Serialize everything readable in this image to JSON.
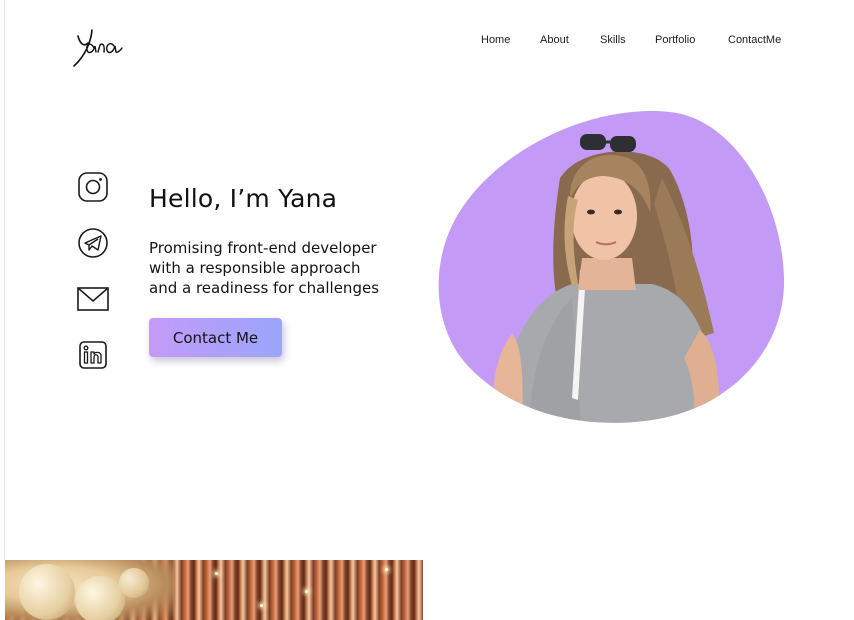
{
  "brand": {
    "logo_text": "Yana"
  },
  "nav": {
    "items": [
      "Home",
      "About",
      "Skills",
      "Portfolio",
      "ContactMe"
    ]
  },
  "social": {
    "icons": [
      "instagram-icon",
      "telegram-icon",
      "mail-icon",
      "linkedin-icon"
    ]
  },
  "hero": {
    "title": "Hello, I’m Yana",
    "description_lines": [
      "Promising front-end developer",
      "with a responsible approach",
      "and a readiness for challenges"
    ],
    "cta_label": "Contact Me"
  },
  "colors": {
    "accent_purple": "#c39bf7",
    "button_gradient_end": "#9aa5fb",
    "text": "#111111",
    "background": "#ffffff"
  }
}
